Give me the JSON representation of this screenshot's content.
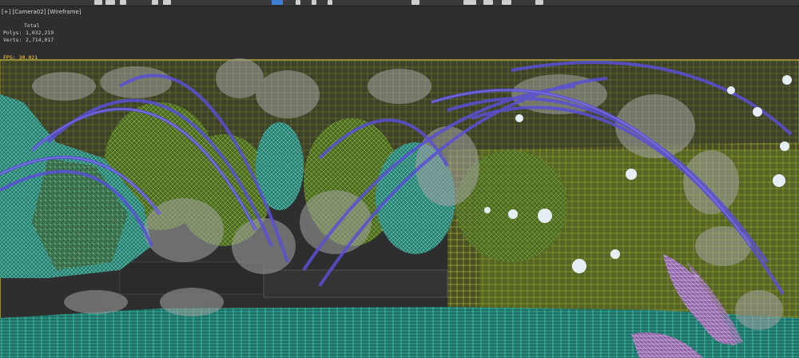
{
  "toolbar": {
    "buttons": 14
  },
  "viewport": {
    "label": "[+] [Camera02] [Wireframe]",
    "stats": {
      "total_label": "Total",
      "polys_label": "Polys:",
      "polys_value": "1,032,219",
      "verts_label": "Verts:",
      "verts_value": "2,714,017"
    },
    "fps_label": "FPS:",
    "fps_value": "30.021"
  },
  "colors": {
    "safe_frame": "#d9c63a",
    "water": "#39d4b0",
    "arc": "#5a4fd6",
    "foliage": "#8bb848",
    "rock": "#6fc79a",
    "grass": "#a0a0a0",
    "flower": "#d8a8e0"
  }
}
